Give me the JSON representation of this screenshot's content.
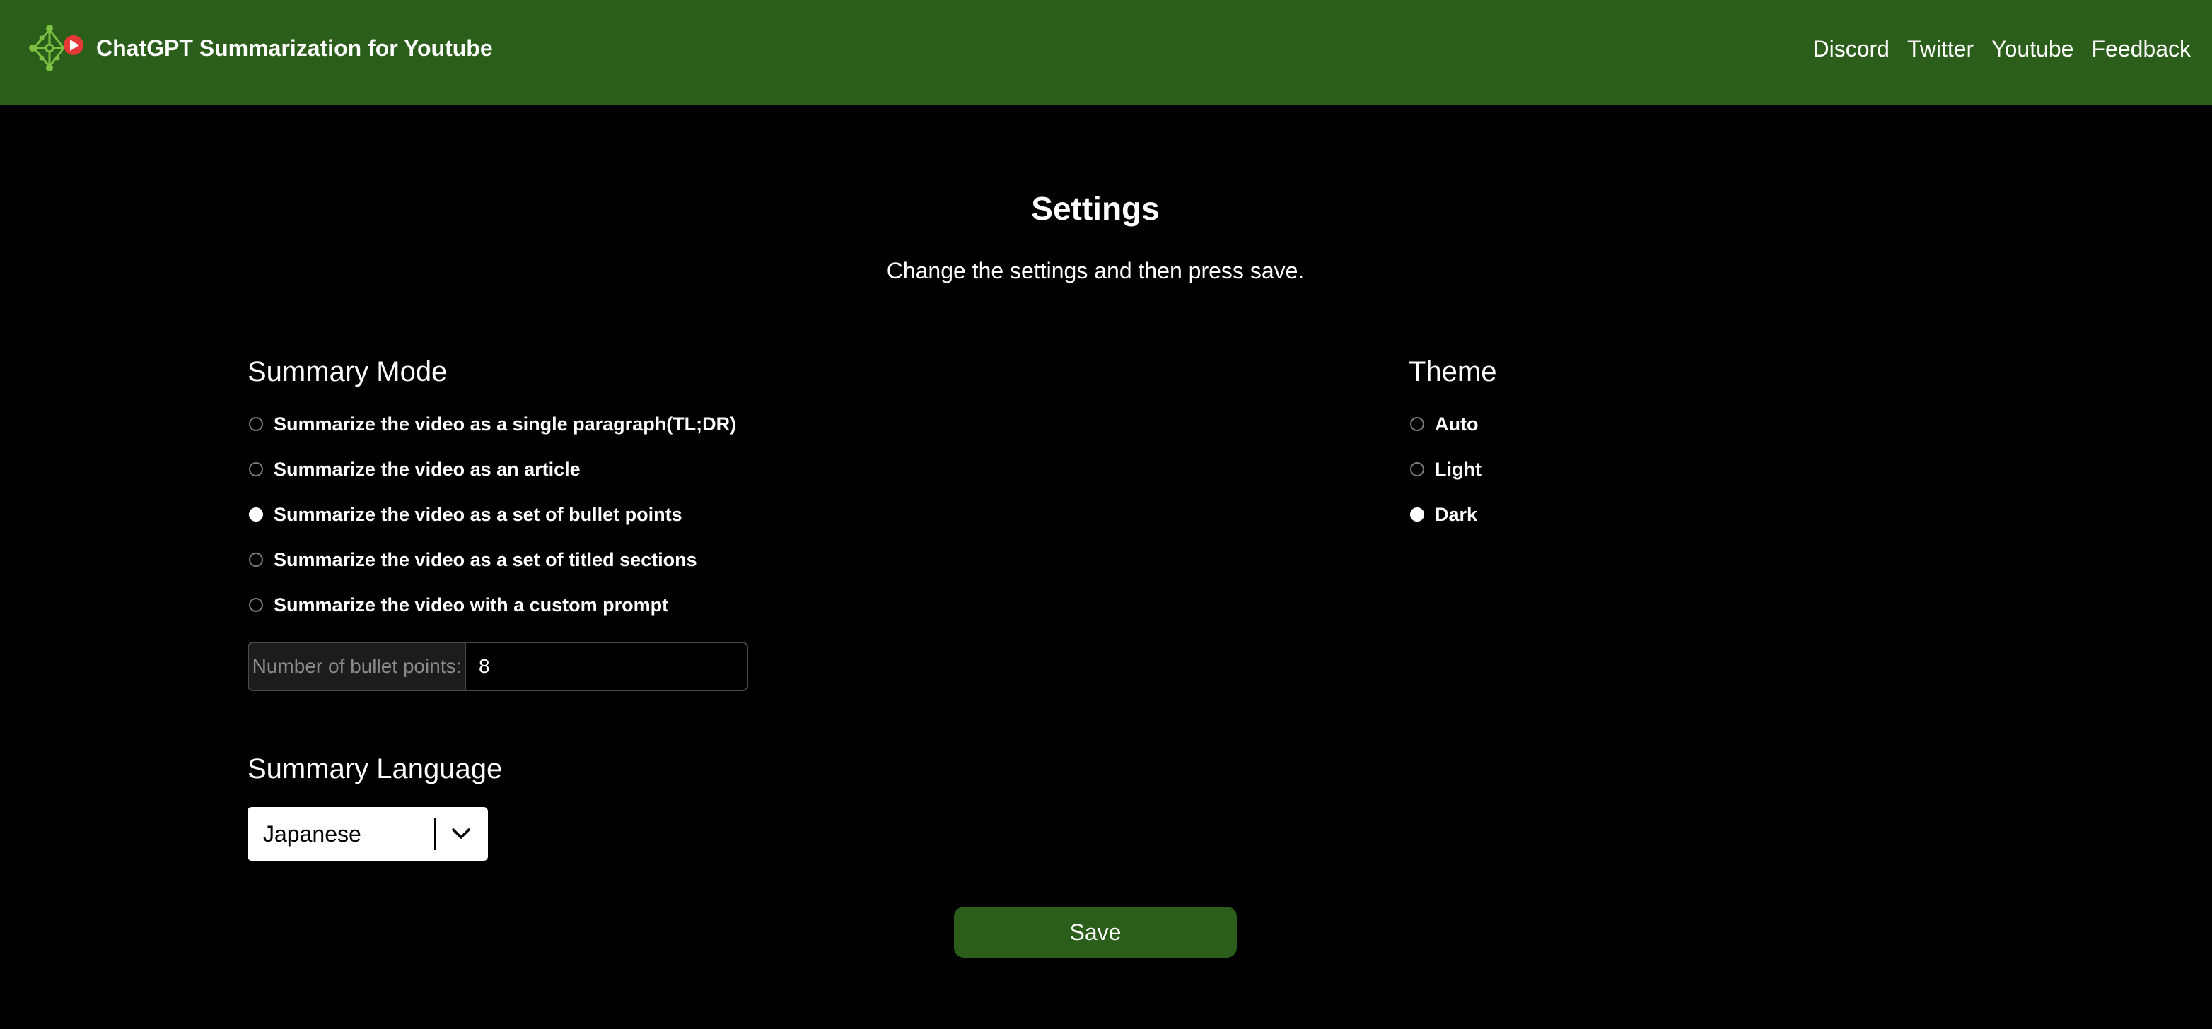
{
  "header": {
    "title": "ChatGPT Summarization for Youtube",
    "logo_icon": "nodes-youtube-logo-icon",
    "nav_links": [
      "Discord",
      "Twitter",
      "Youtube",
      "Feedback"
    ]
  },
  "page": {
    "title": "Settings",
    "subtitle": "Change the settings and then press save."
  },
  "summary_mode": {
    "heading": "Summary Mode",
    "options": [
      {
        "label": "Summarize the video as a single paragraph(TL;DR)",
        "checked": false
      },
      {
        "label": "Summarize the video as an article",
        "checked": false
      },
      {
        "label": "Summarize the video as a set of bullet points",
        "checked": true
      },
      {
        "label": "Summarize the video as a set of titled sections",
        "checked": false
      },
      {
        "label": "Summarize the video with a custom prompt",
        "checked": false
      }
    ],
    "bullet_points_label": "Number of bullet points:",
    "bullet_points_value": "8"
  },
  "theme": {
    "heading": "Theme",
    "options": [
      {
        "label": "Auto",
        "checked": false
      },
      {
        "label": "Light",
        "checked": false
      },
      {
        "label": "Dark",
        "checked": true
      }
    ]
  },
  "summary_language": {
    "heading": "Summary Language",
    "selected": "Japanese"
  },
  "save_label": "Save",
  "colors": {
    "header_bg": "#2a5e1a",
    "page_bg": "#000000",
    "logo_green": "#7bc043",
    "youtube_red": "#e53935"
  }
}
